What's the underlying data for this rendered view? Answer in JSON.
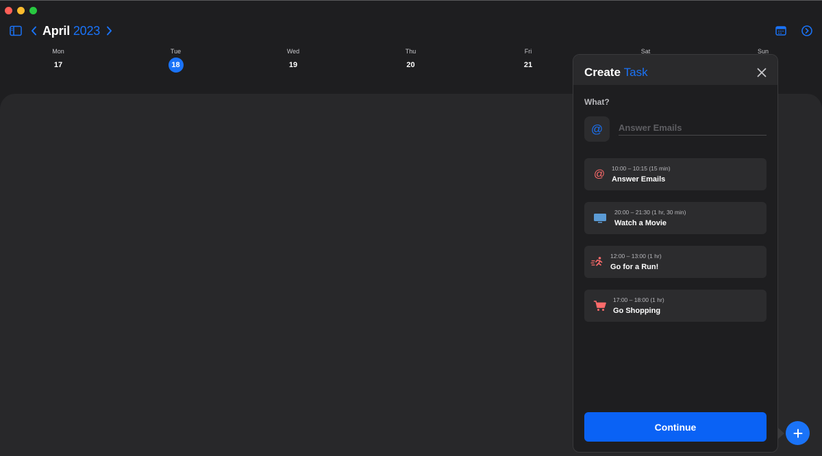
{
  "header": {
    "month": "April",
    "year": "2023"
  },
  "days": [
    {
      "name": "Mon",
      "num": "17",
      "today": false
    },
    {
      "name": "Tue",
      "num": "18",
      "today": true
    },
    {
      "name": "Wed",
      "num": "19",
      "today": false
    },
    {
      "name": "Thu",
      "num": "20",
      "today": false
    },
    {
      "name": "Fri",
      "num": "21",
      "today": false
    },
    {
      "name": "Sat",
      "num": "",
      "today": false
    },
    {
      "name": "Sun",
      "num": "",
      "today": false
    }
  ],
  "panel": {
    "title_word1": "Create",
    "title_word2": "Task",
    "what_label": "What?",
    "input_placeholder": "Answer Emails",
    "input_value": "",
    "continue_label": "Continue",
    "suggestions": [
      {
        "time": "10:00 – 10:15 (15 min)",
        "name": "Answer Emails",
        "icon": "at-sign-icon",
        "color": "#ff6b6b"
      },
      {
        "time": "20:00 – 21:30 (1 hr, 30 min)",
        "name": "Watch a Movie",
        "icon": "tv-icon",
        "color": "#5b9bd5"
      },
      {
        "time": "12:00 – 13:00 (1 hr)",
        "name": "Go for a Run!",
        "icon": "running-icon",
        "color": "#ff6b6b"
      },
      {
        "time": "17:00 – 18:00 (1 hr)",
        "name": "Go Shopping",
        "icon": "shopping-cart-icon",
        "color": "#ff6b6b"
      }
    ]
  },
  "colors": {
    "accent": "#1a73f8",
    "background": "#1e1e20",
    "calendar_body": "#28282a"
  }
}
